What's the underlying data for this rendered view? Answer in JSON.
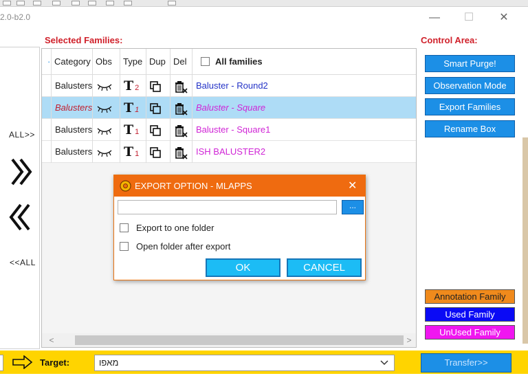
{
  "window": {
    "title": "2.0-b2.0",
    "minimize": "—",
    "maximize": "☐",
    "close": "✕"
  },
  "labels": {
    "selected_families": "Selected Families:",
    "control_area": "Control Area:"
  },
  "left_panel": {
    "all_right": "ALL>>",
    "all_left": "<<ALL"
  },
  "grid": {
    "columns": [
      "Category",
      "Obs",
      "Type",
      "Dup",
      "Del",
      "All families"
    ],
    "rows": [
      {
        "category": "Balusters",
        "type_count": "2",
        "family": "Baluster - Round2",
        "selected": false,
        "used": true
      },
      {
        "category": "Balusters",
        "type_count": "1",
        "family": "Baluster - Square",
        "selected": true,
        "used": false
      },
      {
        "category": "Balusters",
        "type_count": "1",
        "family": "Baluster - Square1",
        "selected": false,
        "used": false
      },
      {
        "category": "Balusters",
        "type_count": "1",
        "family": "ISH BALUSTER2",
        "selected": false,
        "used": false
      }
    ],
    "scroll_left": "<",
    "scroll_right": ">"
  },
  "controls": {
    "smart_purge": "Smart Purge!",
    "observation_mode": "Observation Mode",
    "export_families": "Export Families",
    "rename_box": "Rename Box"
  },
  "legend": {
    "annotation": {
      "label": "Annotation Family",
      "color": "#f08a1c"
    },
    "used": {
      "label": "Used Family",
      "color": "#0a0af5"
    },
    "unused": {
      "label": "UnUsed Family",
      "color": "#f016f0"
    }
  },
  "bottom": {
    "target_label": "Target:",
    "target_value": "מאפו",
    "transfer": "Transfer>>"
  },
  "dialog": {
    "title": "EXPORT OPTION - MLAPPS",
    "path_value": "",
    "browse": "...",
    "export_one_folder": "Export to one folder",
    "open_after_export": "Open folder after export",
    "ok": "OK",
    "cancel": "CANCEL"
  },
  "colors": {
    "accent_blue": "#1c8fe6",
    "dialog_orange": "#ef6b10",
    "bottom_bar_yellow": "#ffd400",
    "selected_row": "#aedcf6",
    "label_red": "#d0202a"
  }
}
